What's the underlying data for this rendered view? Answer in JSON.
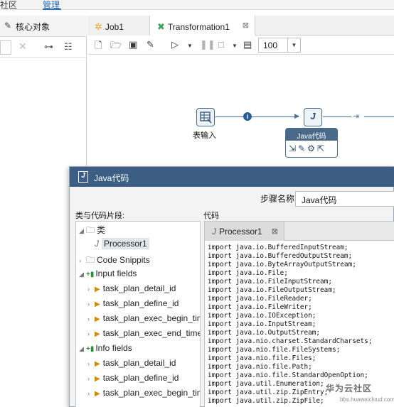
{
  "top_tabs": {
    "left_text": "社区",
    "active_text": "管理"
  },
  "left_panel": {
    "core_objects_label": "核心对象"
  },
  "editor_tabs": [
    {
      "label": "Job1",
      "icon": "job-icon"
    },
    {
      "label": "Transformation1",
      "icon": "transformation-icon",
      "close": "⊠"
    }
  ],
  "toolbar": {
    "zoom_value": "100"
  },
  "canvas": {
    "input_step_label": "表输入",
    "java_step_label": "Java代码"
  },
  "dialog": {
    "title": "Java代码",
    "step_name_label": "步骤名称",
    "step_name_value": "Java代码",
    "snippets_label": "类与代码片段:",
    "code_label": "代码",
    "tree": [
      {
        "label": "类",
        "kind": "folder-open",
        "level": 0
      },
      {
        "label": "Processor1",
        "kind": "class",
        "level": 1,
        "selected": true
      },
      {
        "label": "Code Snippits",
        "kind": "folder",
        "level": 0
      },
      {
        "label": "Input fields",
        "kind": "fields",
        "level": 0
      },
      {
        "label": "task_plan_detail_id",
        "kind": "field",
        "level": 1
      },
      {
        "label": "task_plan_define_id",
        "kind": "field",
        "level": 1
      },
      {
        "label": "task_plan_exec_begin_time",
        "kind": "field",
        "level": 1
      },
      {
        "label": "task_plan_exec_end_time",
        "kind": "field",
        "level": 1
      },
      {
        "label": "Info fields",
        "kind": "fields",
        "level": 0
      },
      {
        "label": "task_plan_detail_id",
        "kind": "field",
        "level": 1
      },
      {
        "label": "task_plan_define_id",
        "kind": "field",
        "level": 1
      },
      {
        "label": "task_plan_exec_begin_time",
        "kind": "field",
        "level": 1
      }
    ],
    "code_tab": {
      "label": "Processor1",
      "close": "⊠"
    },
    "code_lines": [
      "import java.io.BufferedInputStream;",
      "import java.io.BufferedOutputStream;",
      "import java.io.ByteArrayOutputStream;",
      "import java.io.File;",
      "import java.io.FileInputStream;",
      "import java.io.FileOutputStream;",
      "import java.io.FileReader;",
      "import java.io.FileWriter;",
      "import java.io.IOException;",
      "import java.io.InputStream;",
      "import java.io.OutputStream;",
      "import java.nio.charset.StandardCharsets;",
      "import java.nio.file.FileSystems;",
      "import java.nio.file.Files;",
      "import java.nio.file.Path;",
      "import java.nio.file.StandardOpenOption;",
      "import java.util.Enumeration;",
      "import java.util.zip.ZipEntry;",
      "import java.util.zip.ZipFile;"
    ]
  },
  "watermark": {
    "logo": "华为云社区",
    "url": "bbs.huaweicloud.com"
  }
}
